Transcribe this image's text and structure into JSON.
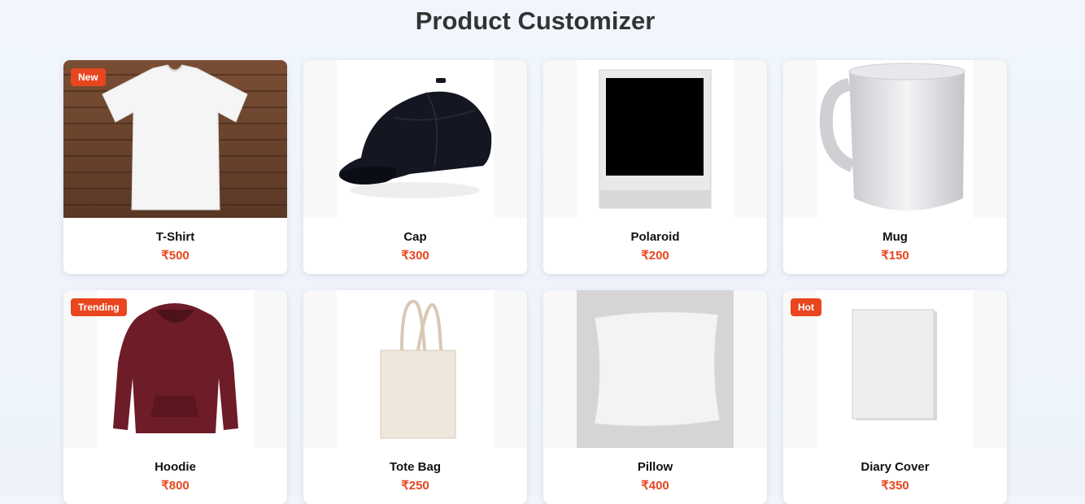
{
  "header": {
    "title": "Product Customizer"
  },
  "colors": {
    "accent": "#e8461f",
    "title": "#333333"
  },
  "products": [
    {
      "name": "T-Shirt",
      "price": "₹500",
      "badge": "New",
      "icon": "tshirt-image"
    },
    {
      "name": "Cap",
      "price": "₹300",
      "badge": "",
      "icon": "cap-image"
    },
    {
      "name": "Polaroid",
      "price": "₹200",
      "badge": "",
      "icon": "polaroid-image"
    },
    {
      "name": "Mug",
      "price": "₹150",
      "badge": "",
      "icon": "mug-image"
    },
    {
      "name": "Hoodie",
      "price": "₹800",
      "badge": "Trending",
      "icon": "hoodie-image"
    },
    {
      "name": "Tote Bag",
      "price": "₹250",
      "badge": "",
      "icon": "tote-bag-image"
    },
    {
      "name": "Pillow",
      "price": "₹400",
      "badge": "",
      "icon": "pillow-image"
    },
    {
      "name": "Diary Cover",
      "price": "₹350",
      "badge": "Hot",
      "icon": "diary-cover-image"
    }
  ]
}
